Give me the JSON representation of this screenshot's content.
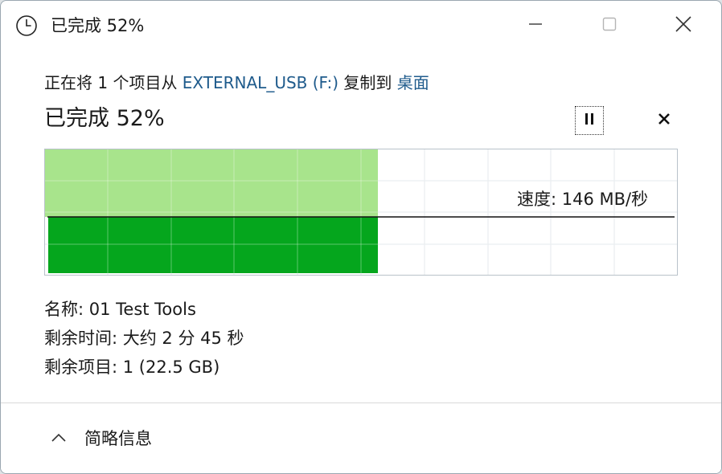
{
  "window": {
    "title": "已完成 52%"
  },
  "header": {
    "copy_prefix": "正在将 1 个项目从 ",
    "source": "EXTERNAL_USB (F:)",
    "copy_middle": " 复制到 ",
    "destination": "桌面",
    "progress_text": "已完成 52%"
  },
  "transfer": {
    "percent_complete": 52,
    "speed_label": "速度: 146 MB/秒"
  },
  "details": {
    "name_line": "名称: 01 Test Tools",
    "time_remaining_line": "剩余时间: 大约 2 分 45 秒",
    "items_remaining_line": "剩余项目: 1 (22.5 GB)"
  },
  "footer": {
    "toggle_label": "简略信息"
  },
  "colors": {
    "progress_light": "#a8e48c",
    "progress_dark": "#05a61d",
    "link": "#1f5b8c",
    "grid": "#d6dde3"
  },
  "icons": {
    "title": "clock-icon",
    "minimize": "minimize-icon",
    "maximize": "maximize-icon",
    "close": "close-icon",
    "pause": "pause-icon",
    "cancel": "cancel-icon",
    "collapse": "chevron-up-icon"
  }
}
